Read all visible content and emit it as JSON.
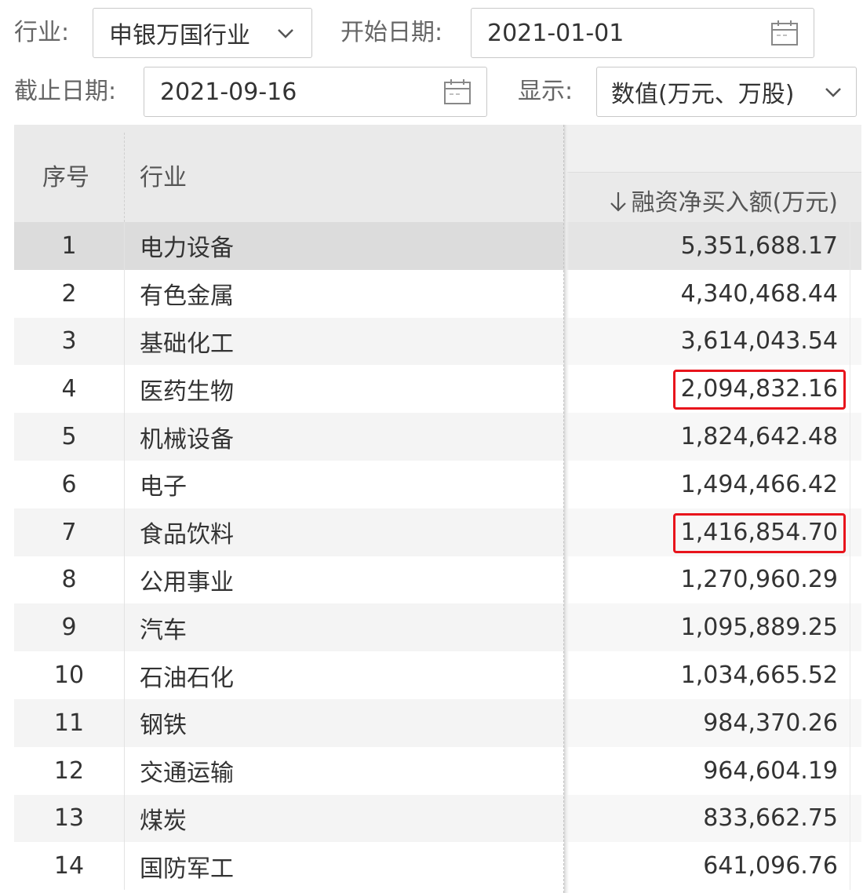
{
  "filters": {
    "industry_label": "行业:",
    "industry_value": "申银万国行业",
    "start_label": "开始日期:",
    "start_value": "2021-01-01",
    "end_label": "截止日期:",
    "end_value": "2021-09-16",
    "display_label": "显示:",
    "display_value": "数值(万元、万股)"
  },
  "table": {
    "headers": {
      "seq": "序号",
      "industry": "行业",
      "value": "融资净买入额(万元)"
    },
    "sort_direction": "descending",
    "rows": [
      {
        "seq": "1",
        "industry": "电力设备",
        "value": "5,351,688.17",
        "selected": true,
        "highlighted": false
      },
      {
        "seq": "2",
        "industry": "有色金属",
        "value": "4,340,468.44",
        "selected": false,
        "highlighted": false
      },
      {
        "seq": "3",
        "industry": "基础化工",
        "value": "3,614,043.54",
        "selected": false,
        "highlighted": false
      },
      {
        "seq": "4",
        "industry": "医药生物",
        "value": "2,094,832.16",
        "selected": false,
        "highlighted": true
      },
      {
        "seq": "5",
        "industry": "机械设备",
        "value": "1,824,642.48",
        "selected": false,
        "highlighted": false
      },
      {
        "seq": "6",
        "industry": "电子",
        "value": "1,494,466.42",
        "selected": false,
        "highlighted": false
      },
      {
        "seq": "7",
        "industry": "食品饮料",
        "value": "1,416,854.70",
        "selected": false,
        "highlighted": true
      },
      {
        "seq": "8",
        "industry": "公用事业",
        "value": "1,270,960.29",
        "selected": false,
        "highlighted": false
      },
      {
        "seq": "9",
        "industry": "汽车",
        "value": "1,095,889.25",
        "selected": false,
        "highlighted": false
      },
      {
        "seq": "10",
        "industry": "石油石化",
        "value": "1,034,665.52",
        "selected": false,
        "highlighted": false
      },
      {
        "seq": "11",
        "industry": "钢铁",
        "value": "984,370.26",
        "selected": false,
        "highlighted": false
      },
      {
        "seq": "12",
        "industry": "交通运输",
        "value": "964,604.19",
        "selected": false,
        "highlighted": false
      },
      {
        "seq": "13",
        "industry": "煤炭",
        "value": "833,662.75",
        "selected": false,
        "highlighted": false
      },
      {
        "seq": "14",
        "industry": "国防军工",
        "value": "641,096.76",
        "selected": false,
        "highlighted": false
      }
    ]
  },
  "colors": {
    "highlight_border": "#e8141c",
    "header_bg": "#eaeaea",
    "selected_row_bg": "#dcdcdc"
  },
  "icons": {
    "dropdown": "chevron-down-icon",
    "date": "calendar-icon",
    "sort": "arrow-down-icon"
  }
}
